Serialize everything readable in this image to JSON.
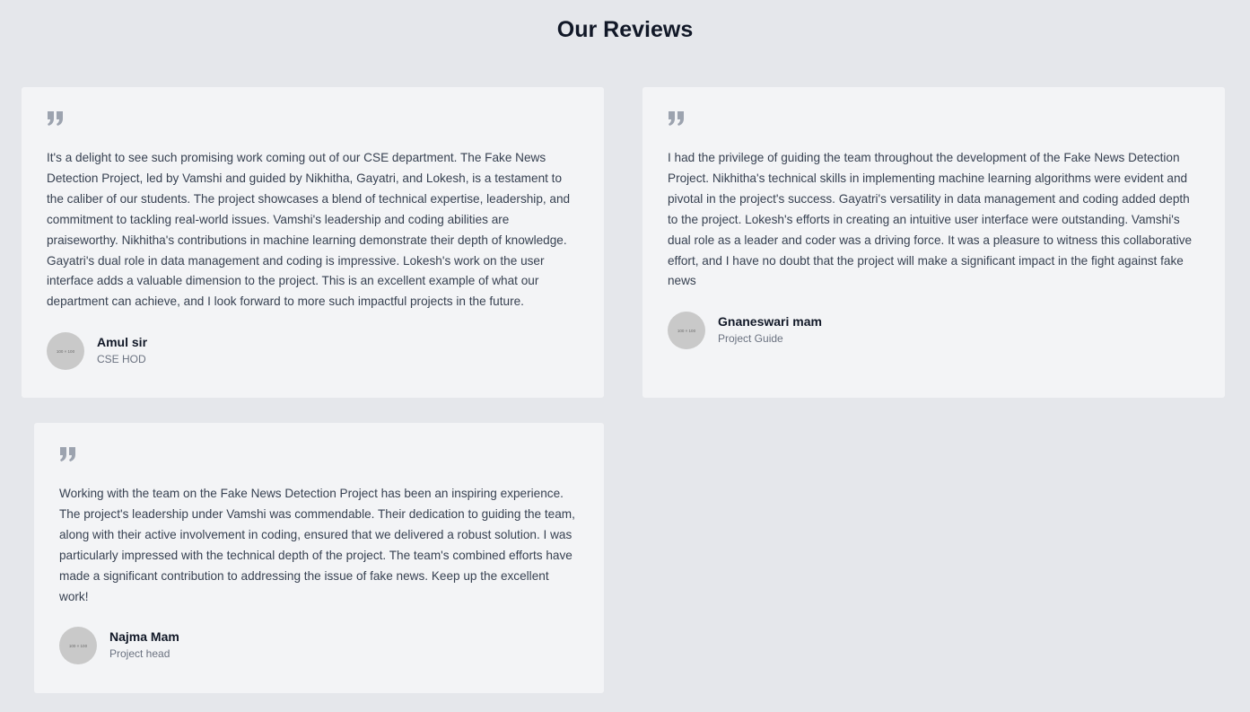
{
  "page": {
    "title": "Our Reviews"
  },
  "colors": {
    "background": "#e5e7eb",
    "card": "#f3f4f6",
    "quote_icon": "#9ca3af",
    "avatar": "#c9c9c9"
  },
  "reviews": [
    {
      "icon": "quote-icon",
      "text": "It's a delight to see such promising work coming out of our CSE department. The Fake News Detection Project, led by Vamshi and guided by Nikhitha, Gayatri, and Lokesh, is a testament to the caliber of our students. The project showcases a blend of technical expertise, leadership, and commitment to tackling real-world issues. Vamshi's leadership and coding abilities are praiseworthy. Nikhitha's contributions in machine learning demonstrate their depth of knowledge. Gayatri's dual role in data management and coding is impressive. Lokesh's work on the user interface adds a valuable dimension to the project. This is an excellent example of what our department can achieve, and I look forward to more such impactful projects in the future.",
      "avatar_text": "100 × 100",
      "name": "Amul sir",
      "role": "CSE HOD"
    },
    {
      "icon": "quote-icon",
      "text": "I had the privilege of guiding the team throughout the development of the Fake News Detection Project. Nikhitha's technical skills in implementing machine learning algorithms were evident and pivotal in the project's success. Gayatri's versatility in data management and coding added depth to the project. Lokesh's efforts in creating an intuitive user interface were outstanding. Vamshi's dual role as a leader and coder was a driving force. It was a pleasure to witness this collaborative effort, and I have no doubt that the project will make a significant impact in the fight against fake news",
      "avatar_text": "100 × 100",
      "name": "Gnaneswari mam",
      "role": "Project Guide"
    },
    {
      "icon": "quote-icon",
      "text": "Working with the team on the Fake News Detection Project has been an inspiring experience. The project's leadership under Vamshi was commendable. Their dedication to guiding the team, along with their active involvement in coding, ensured that we delivered a robust solution. I was particularly impressed with the technical depth of the project. The team's combined efforts have made a significant contribution to addressing the issue of fake news. Keep up the excellent work!",
      "avatar_text": "100 × 100",
      "name": "Najma Mam",
      "role": "Project head"
    }
  ]
}
